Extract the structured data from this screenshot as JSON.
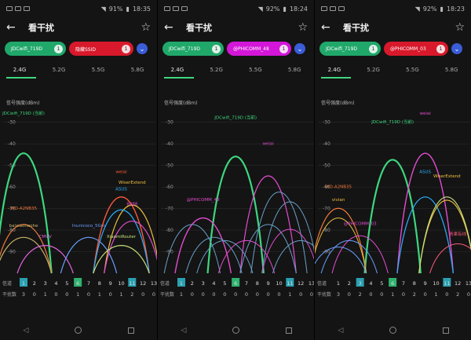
{
  "colors": {
    "bg": "#141414",
    "green": "#20a86a",
    "red": "#d8192b",
    "magenta": "#d316d8",
    "blue": "#3a5dd8",
    "accent": "#3ed77f"
  },
  "panels": [
    {
      "status": {
        "battery": "91%",
        "time": "18:35"
      },
      "title": "看干扰",
      "chips": [
        {
          "label": "JDCwifi_719D",
          "count": "1",
          "color": "green"
        },
        {
          "label": "隐藏SSID",
          "count": "1",
          "color": "red"
        }
      ],
      "tabs": [
        "2.4G",
        "5.2G",
        "5.5G",
        "5.8G"
      ],
      "active_tab": "2.4G",
      "y_title": "信号强度(dBm)",
      "y_ticks": [
        "-30",
        "-40",
        "-50",
        "-60",
        "-70",
        "-80",
        "-90"
      ],
      "channel_label": "信道",
      "interference_label": "干扰数",
      "channels": [
        "1",
        "2",
        "3",
        "4",
        "5",
        "6",
        "7",
        "8",
        "9",
        "10",
        "11",
        "12",
        "13"
      ],
      "interference": [
        "3",
        "0",
        "1",
        "0",
        "0",
        "1",
        "0",
        "1",
        "0",
        "1",
        "2",
        "0",
        "0"
      ],
      "highlight_channels": [
        "1",
        "6",
        "11"
      ],
      "networks": [
        {
          "name": "JDCwifi_719D (当前)",
          "channel": 1,
          "dbm": -28,
          "color": "#3ed77f",
          "w": 2.2
        },
        {
          "name": "WO-A2NB35",
          "channel": 1,
          "dbm": -72,
          "color": "#f07a3a",
          "w": 1.2
        },
        {
          "name": "baixiaohaohe",
          "channel": 1,
          "dbm": -80,
          "color": "#c8b26a",
          "w": 1.2
        },
        {
          "name": "CMVV",
          "channel": 3,
          "dbm": -85,
          "color": "#e065e0",
          "w": 1.2
        },
        {
          "name": "Inunicoco_5Gm",
          "channel": 7,
          "dbm": -80,
          "color": "#6aa0ff",
          "w": 1.2
        },
        {
          "name": "weiai",
          "channel": 10,
          "dbm": -55,
          "color": "#ff5a3a",
          "w": 1.4
        },
        {
          "name": "WiserExtend",
          "channel": 11,
          "dbm": -60,
          "color": "#f0c040",
          "w": 1.2
        },
        {
          "name": "ASUS",
          "channel": 10,
          "dbm": -63,
          "color": "#2bb0ff",
          "w": 1.2
        },
        {
          "name": "8888",
          "channel": 11,
          "dbm": -70,
          "color": "#e34dd0",
          "w": 1.2
        },
        {
          "name": "XiaomiRouter",
          "channel": 10,
          "dbm": -85,
          "color": "#c4e07a",
          "w": 1.2
        }
      ]
    },
    {
      "status": {
        "battery": "92%",
        "time": "18:24"
      },
      "title": "看干扰",
      "chips": [
        {
          "label": "JDCwifi_719D",
          "count": "1",
          "color": "green"
        },
        {
          "label": "@PHICOMM_48",
          "count": "1",
          "color": "magenta"
        }
      ],
      "tabs": [
        "2.4G",
        "5.2G",
        "5.5G",
        "5.8G"
      ],
      "active_tab": "2.4G",
      "y_title": "信号强度(dBm)",
      "y_ticks": [
        "-30",
        "-40",
        "-50",
        "-60",
        "-70",
        "-80",
        "-90"
      ],
      "channel_label": "信道",
      "interference_label": "干扰数",
      "channels": [
        "1",
        "2",
        "3",
        "4",
        "5",
        "6",
        "7",
        "8",
        "9",
        "10",
        "11",
        "12",
        "13"
      ],
      "interference": [
        "1",
        "0",
        "0",
        "0",
        "0",
        "0",
        "0",
        "0",
        "0",
        "0",
        "1",
        "0",
        "0"
      ],
      "highlight_channels": [
        "1",
        "6",
        "11"
      ],
      "networks": [
        {
          "name": "JDCwifi_719D (当前)",
          "channel": 6,
          "dbm": -30,
          "color": "#3ed77f",
          "w": 2.2
        },
        {
          "name": "@PHICOMM_48",
          "channel": 3,
          "dbm": -68,
          "color": "#e34dd0",
          "w": 1.4
        },
        {
          "name": "weiai",
          "channel": 9,
          "dbm": -42,
          "color": "#e34dd0",
          "w": 1.2
        },
        {
          "name": "",
          "channel": 10,
          "dbm": -52,
          "color": "#6aa0c8",
          "w": 1.0
        },
        {
          "name": "",
          "channel": 11,
          "dbm": -58,
          "color": "#6aa0c8",
          "w": 1.0
        },
        {
          "name": "",
          "channel": 9,
          "dbm": -72,
          "color": "#6aa0c8",
          "w": 1.0
        },
        {
          "name": "",
          "channel": 2,
          "dbm": -72,
          "color": "#6aa0c8",
          "w": 1.0
        },
        {
          "name": "",
          "channel": 4,
          "dbm": -80,
          "color": "#6aa0c8",
          "w": 1.0
        },
        {
          "name": "",
          "channel": 7,
          "dbm": -82,
          "color": "#e34dd0",
          "w": 1.0
        },
        {
          "name": "",
          "channel": 5,
          "dbm": -82,
          "color": "#6aa0c8",
          "w": 1.0
        },
        {
          "name": "",
          "channel": 11,
          "dbm": -75,
          "color": "#e34dd0",
          "w": 1.0
        },
        {
          "name": "",
          "channel": 12,
          "dbm": -82,
          "color": "#6aa0c8",
          "w": 1.0
        }
      ]
    },
    {
      "status": {
        "battery": "92%",
        "time": "18:23"
      },
      "title": "看干扰",
      "chips": [
        {
          "label": "JDCwifi_719D",
          "count": "1",
          "color": "green"
        },
        {
          "label": "@PHICOMM_03",
          "count": "1",
          "color": "red"
        }
      ],
      "tabs": [
        "2.4G",
        "5.2G",
        "5.5G",
        "5.8G"
      ],
      "active_tab": "2.4G",
      "y_title": "信号强度(dBm)",
      "y_ticks": [
        "-30",
        "-40",
        "-50",
        "-60",
        "-70",
        "-80",
        "-90"
      ],
      "channel_label": "信道",
      "interference_label": "干扰数",
      "channels": [
        "1",
        "2",
        "3",
        "4",
        "5",
        "6",
        "7",
        "8",
        "9",
        "10",
        "11",
        "12",
        "13"
      ],
      "interference": [
        "3",
        "0",
        "2",
        "0",
        "0",
        "1",
        "0",
        "2",
        "0",
        "1",
        "0",
        "2",
        "0"
      ],
      "highlight_channels": [
        "3",
        "6",
        "11"
      ],
      "networks": [
        {
          "name": "JDCwifi_719D (当前)",
          "channel": 6,
          "dbm": -32,
          "color": "#3ed77f",
          "w": 2.2
        },
        {
          "name": "weiai",
          "channel": 9,
          "dbm": -28,
          "color": "#e34dd0",
          "w": 1.4
        },
        {
          "name": "ASUS",
          "channel": 9,
          "dbm": -55,
          "color": "#2bb0ff",
          "w": 1.2
        },
        {
          "name": "WiserExtend",
          "channel": 11,
          "dbm": -57,
          "color": "#f0c040",
          "w": 1.2
        },
        {
          "name": "",
          "channel": 11,
          "dbm": -55,
          "color": "#c4e07a",
          "w": 1.2
        },
        {
          "name": "WO-A2NB35",
          "channel": 1,
          "dbm": -62,
          "color": "#f07a3a",
          "w": 1.2
        },
        {
          "name": "vivian",
          "channel": 1,
          "dbm": -68,
          "color": "#f0c040",
          "w": 1.0
        },
        {
          "name": "@PHICOMM_03",
          "channel": 3,
          "dbm": -79,
          "color": "#e34dd0",
          "w": 1.0
        },
        {
          "name": "",
          "channel": 2,
          "dbm": -82,
          "color": "#6aa0ff",
          "w": 1.0
        },
        {
          "name": "",
          "channel": 1,
          "dbm": -86,
          "color": "#6aa0ff",
          "w": 1.0
        },
        {
          "name": "青果有线",
          "channel": 12,
          "dbm": -84,
          "color": "#ff5a7a",
          "w": 1.0
        }
      ]
    }
  ]
}
